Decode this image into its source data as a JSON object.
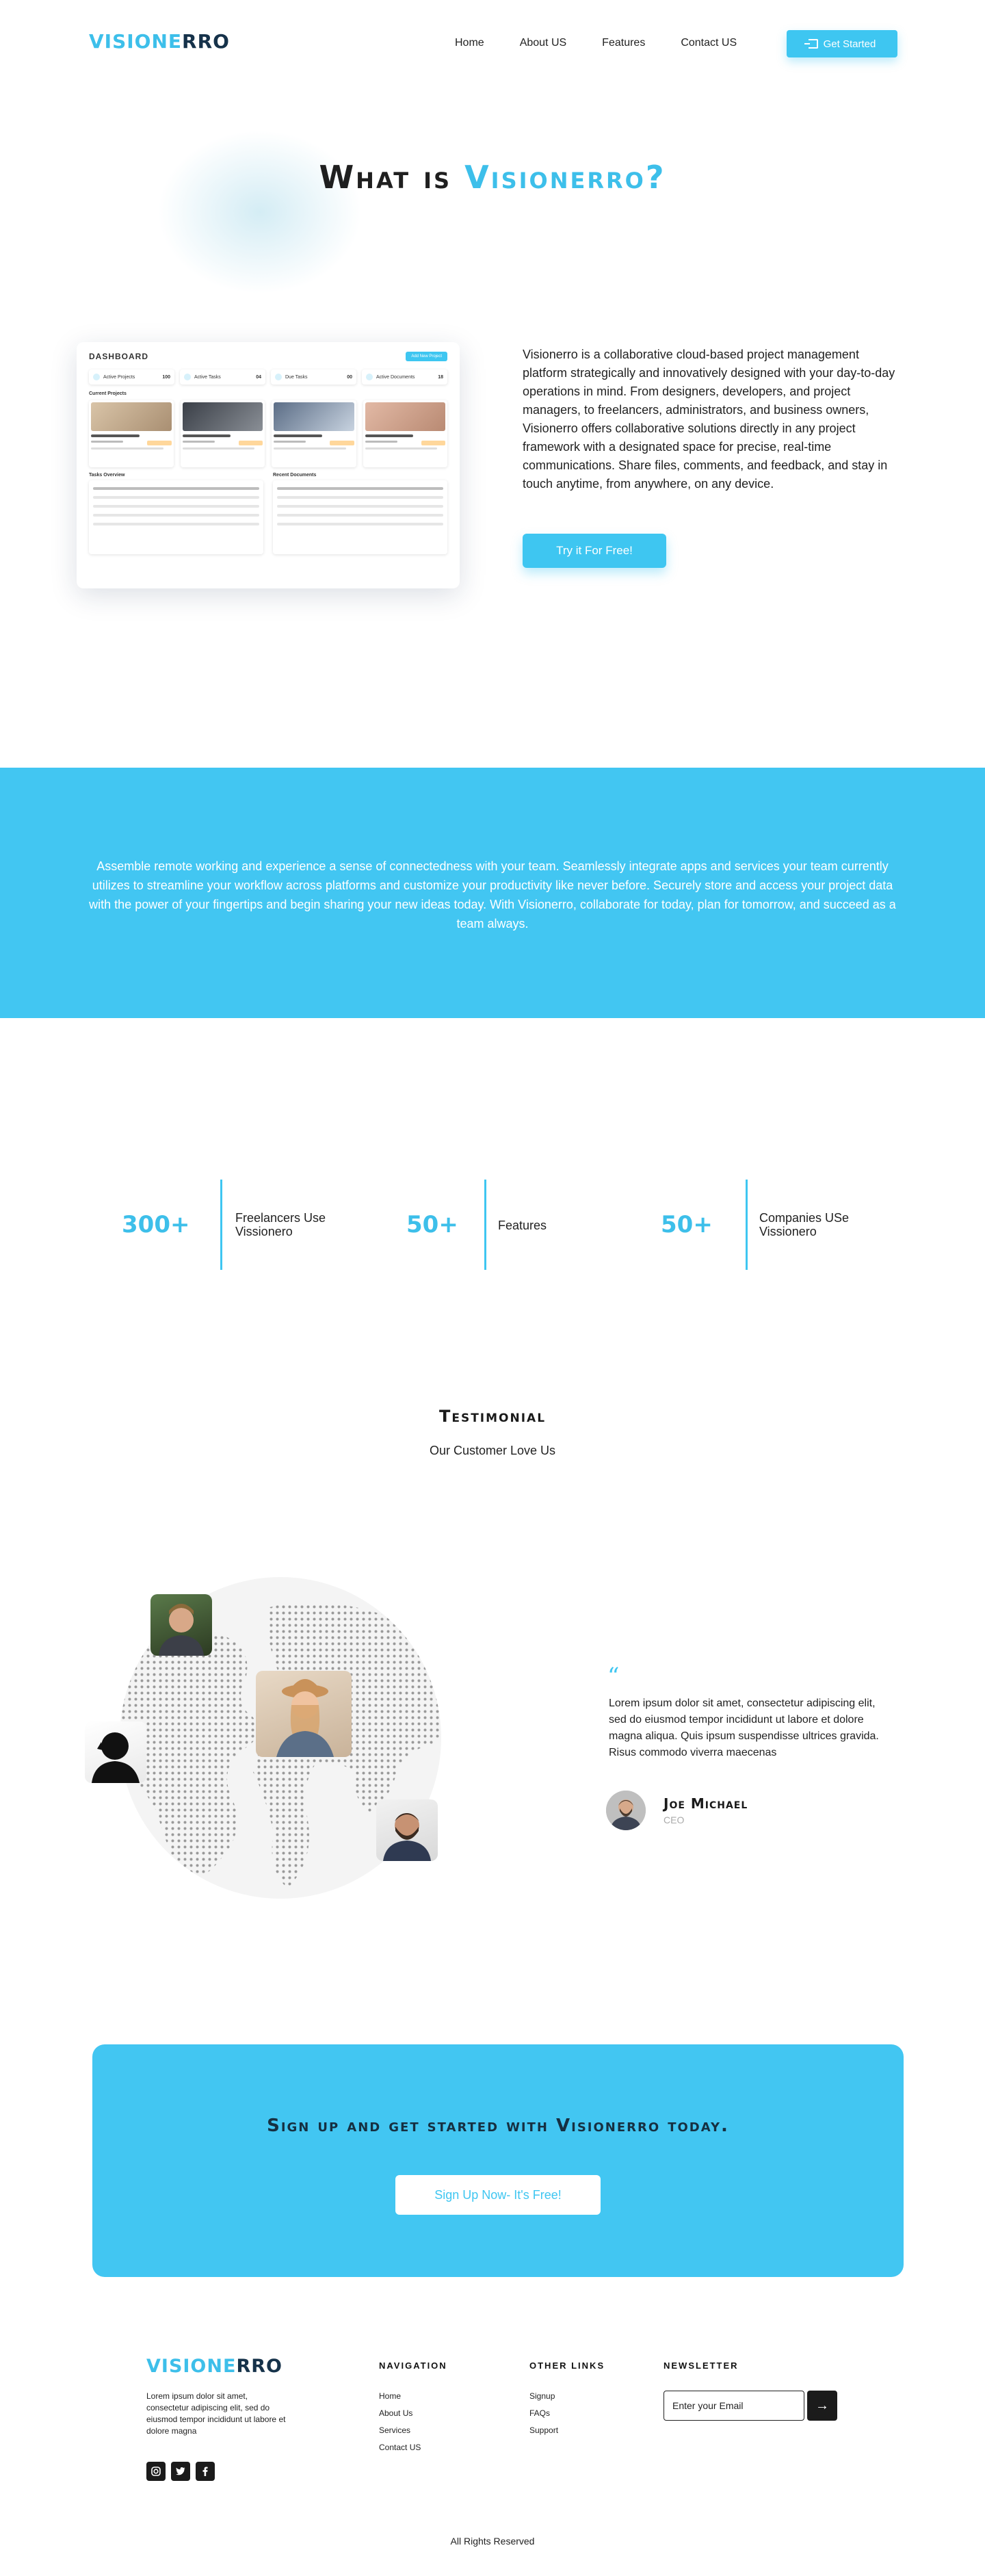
{
  "header": {
    "logo_main": "VISIONE",
    "logo_end": "RRO",
    "nav": [
      "Home",
      "About US",
      "Features",
      "Contact US"
    ],
    "cta_label": "Get Started"
  },
  "hero": {
    "title_prefix": "What is ",
    "title_accent": "Visionerro?"
  },
  "dashboard": {
    "title": "DASHBOARD",
    "add_button": "Add New Project",
    "stats": [
      {
        "label": "Active Projects",
        "value": "100"
      },
      {
        "label": "Active Tasks",
        "value": "04"
      },
      {
        "label": "Due Tasks",
        "value": "00"
      },
      {
        "label": "Active Documents",
        "value": "18"
      }
    ],
    "current_projects_label": "Current Projects",
    "tasks_label": "Tasks Overview",
    "docs_label": "Recent Documents"
  },
  "about": {
    "text": "Visionerro is a collaborative cloud-based project management platform strategically and innovatively designed with your day-to-day operations in mind. From designers, developers, and project managers, to freelancers, administrators, and business owners, Visionerro offers collaborative solutions directly in any project framework with a designated space for precise, real-time communications. Share files, comments, and feedback, and stay in touch anytime, from anywhere, on any device.",
    "cta_label": "Try it For Free!"
  },
  "band": {
    "text": "Assemble remote working and experience a sense of connectedness with your team. Seamlessly integrate apps and services your team currently utilizes to streamline your workflow across platforms and customize your productivity like never before. Securely store and access your project data with the power of your fingertips and begin sharing your new ideas today. With Visionerro, collaborate for today, plan for tomorrow, and succeed as a team always."
  },
  "stats": [
    {
      "number": "300+",
      "label_1": "Freelancers Use",
      "label_2": "Vissionero"
    },
    {
      "number": "50+",
      "label_1": "Features",
      "label_2": ""
    },
    {
      "number": "50+",
      "label_1": "Companies USe",
      "label_2": "Vissionero"
    }
  ],
  "testimonial": {
    "heading": "Testimonial",
    "subheading": "Our Customer Love Us",
    "quote": "Lorem ipsum dolor sit amet, consectetur adipiscing elit, sed do eiusmod tempor incididunt ut labore et dolore magna aliqua. Quis ipsum suspendisse ultrices gravida. Risus commodo viverra maecenas",
    "name": "Joe Michael",
    "role": "CEO"
  },
  "cta": {
    "heading": "Sign up and get started with Visionerro today.",
    "button": "Sign Up Now- It's Free!"
  },
  "footer": {
    "description": "Lorem ipsum dolor sit amet, consectetur adipiscing elit, sed do eiusmod tempor incididunt ut labore et dolore magna",
    "nav_heading": "NAVIGATION",
    "nav_links": [
      "Home",
      "About Us",
      "Services",
      "Contact US"
    ],
    "other_heading": "OTHER LINKS",
    "other_links": [
      "Signup",
      "FAQs",
      "Support"
    ],
    "newsletter_heading": "NEWSLETTER",
    "newsletter_placeholder": "Enter your Email",
    "copyright": "All Rights Reserved"
  },
  "colors": {
    "accent": "#3ec6f1",
    "band": "#42c6f2",
    "dark": "#1b1b1b"
  },
  "icons": {
    "get_started": "login-icon",
    "socials": [
      "instagram-icon",
      "twitter-icon",
      "facebook-icon"
    ],
    "newsletter_submit": "arrow-right-icon",
    "quote": "quote-icon"
  }
}
